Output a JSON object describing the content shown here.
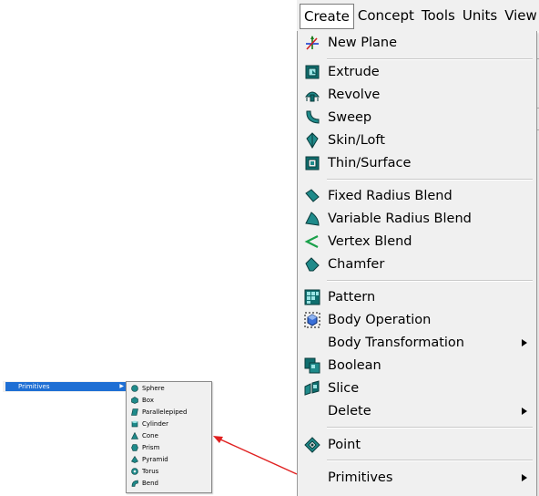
{
  "menubar": {
    "items": [
      "Create",
      "Concept",
      "Tools",
      "Units",
      "View"
    ]
  },
  "create_menu": {
    "items": {
      "new_plane": "New Plane",
      "extrude": "Extrude",
      "revolve": "Revolve",
      "sweep": "Sweep",
      "skin_loft": "Skin/Loft",
      "thin_surface": "Thin/Surface",
      "fixed_radius_blend": "Fixed Radius Blend",
      "variable_radius_blend": "Variable Radius Blend",
      "vertex_blend": "Vertex Blend",
      "chamfer": "Chamfer",
      "pattern": "Pattern",
      "body_operation": "Body Operation",
      "body_transformation": "Body Transformation",
      "boolean": "Boolean",
      "slice": "Slice",
      "delete": "Delete",
      "point": "Point",
      "primitives": "Primitives"
    },
    "submenu_arrow": "▶"
  },
  "primitives_inset": {
    "label": "Primitives",
    "arrow": "▶",
    "items": [
      "Sphere",
      "Box",
      "Parallelepiped",
      "Cylinder",
      "Cone",
      "Prism",
      "Pyramid",
      "Torus",
      "Bend"
    ]
  },
  "colors": {
    "menu_bg": "#f0f0f0",
    "icon_teal": "#1f8a8a",
    "highlight_blue": "#1f6fd4",
    "arrow_red": "#e02020"
  }
}
